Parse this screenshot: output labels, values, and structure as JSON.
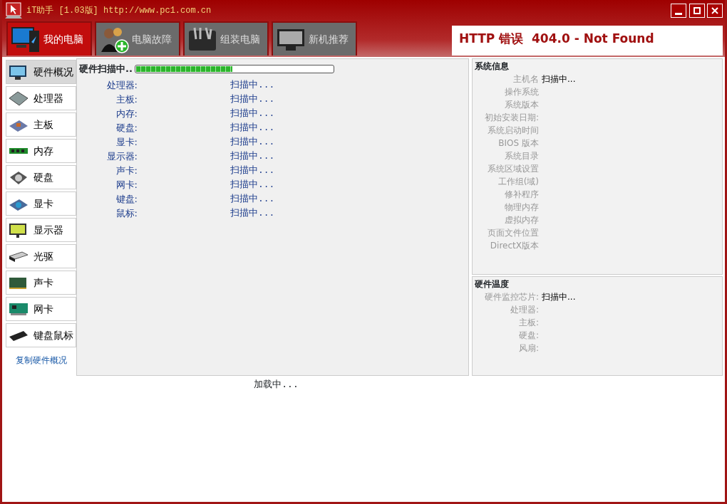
{
  "window": {
    "title": "iT助手 [1.03版] http://www.pc1.com.cn"
  },
  "tabs": [
    {
      "label": "我的电脑",
      "selected": true
    },
    {
      "label": "电脑故障",
      "selected": false
    },
    {
      "label": "组装电脑",
      "selected": false
    },
    {
      "label": "新机推荐",
      "selected": false
    }
  ],
  "web_panel": {
    "heading": "HTTP 错误  404.0 - Not Found"
  },
  "sidebar": {
    "items": [
      {
        "label": "硬件概况",
        "selected": true
      },
      {
        "label": "处理器",
        "selected": false
      },
      {
        "label": "主板",
        "selected": false
      },
      {
        "label": "内存",
        "selected": false
      },
      {
        "label": "硬盘",
        "selected": false
      },
      {
        "label": "显卡",
        "selected": false
      },
      {
        "label": "显示器",
        "selected": false
      },
      {
        "label": "光驱",
        "selected": false
      },
      {
        "label": "声卡",
        "selected": false
      },
      {
        "label": "网卡",
        "selected": false
      },
      {
        "label": "键盘鼠标",
        "selected": false
      }
    ],
    "link": "复制硬件概况"
  },
  "scan": {
    "title": "硬件扫描中..",
    "level": 0.49,
    "rows": [
      {
        "label": "处理器:",
        "value": "扫描中..."
      },
      {
        "label": "主板:",
        "value": "扫描中..."
      },
      {
        "label": "内存:",
        "value": "扫描中..."
      },
      {
        "label": "硬盘:",
        "value": "扫描中..."
      },
      {
        "label": "显卡:",
        "value": "扫描中..."
      },
      {
        "label": "显示器:",
        "value": "扫描中..."
      },
      {
        "label": "声卡:",
        "value": "扫描中..."
      },
      {
        "label": "网卡:",
        "value": "扫描中..."
      },
      {
        "label": "键盘:",
        "value": "扫描中..."
      },
      {
        "label": "鼠标:",
        "value": "扫描中..."
      }
    ]
  },
  "system_info": {
    "title": "系统信息",
    "rows": [
      {
        "label": "主机名",
        "value": "扫描中..."
      },
      {
        "label": "操作系统"
      },
      {
        "label": "系统版本"
      },
      {
        "label": "初始安装日期:"
      },
      {
        "label": "系统启动时间"
      },
      {
        "label": "BIOS 版本"
      },
      {
        "label": "系统目录"
      },
      {
        "label": "系统区域设置"
      },
      {
        "label": "工作组(域)"
      },
      {
        "label": "修补程序"
      },
      {
        "label": "物理内存"
      },
      {
        "label": "虚拟内存"
      },
      {
        "label": "页面文件位置"
      },
      {
        "label": "DirectX版本"
      }
    ]
  },
  "temperature": {
    "title": "硬件温度",
    "rows": [
      {
        "label": "硬件监控芯片:",
        "value": "扫描中..."
      },
      {
        "label": "处理器:"
      },
      {
        "label": "主板:"
      },
      {
        "label": "硬盘:"
      },
      {
        "label": "风扇:"
      }
    ]
  },
  "status": "加载中..."
}
